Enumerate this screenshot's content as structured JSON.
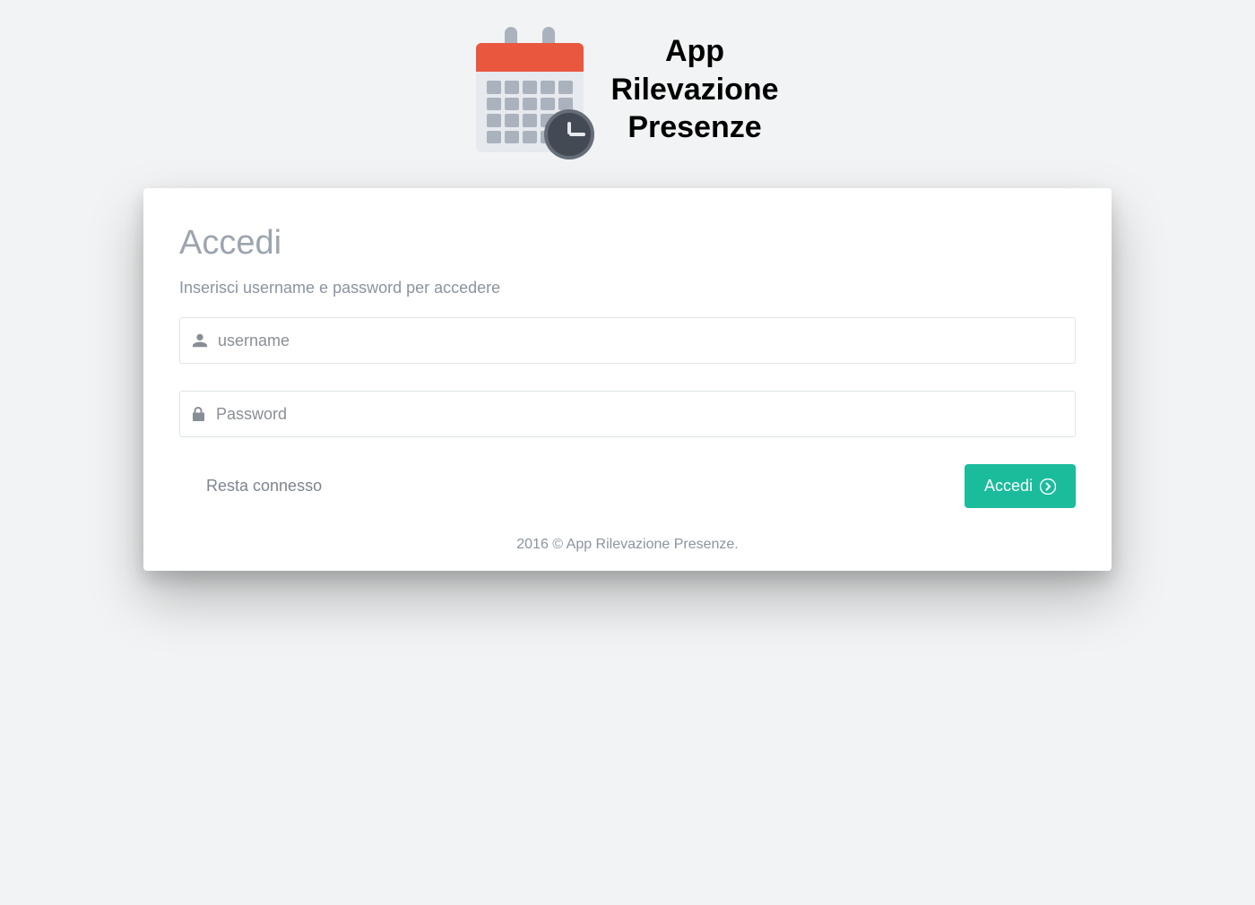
{
  "app": {
    "title_line1": "App",
    "title_line2": "Rilevazione",
    "title_line3": "Presenze"
  },
  "login": {
    "heading": "Accedi",
    "subtitle": "Inserisci username e password per accedere",
    "username_placeholder": "username",
    "password_placeholder": "Password",
    "remember_label": "Resta connesso",
    "submit_label": "Accedi"
  },
  "footer": {
    "text": "2016 © App Rilevazione Presenze."
  }
}
